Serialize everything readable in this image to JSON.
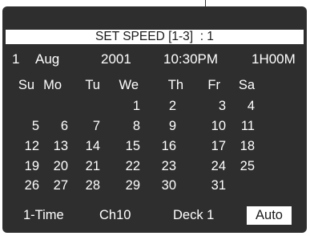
{
  "header": {
    "title": "SET SPEED [1-3]  : 1"
  },
  "date_line": {
    "day": "1",
    "month": "Aug",
    "year": "2001",
    "time": "10:30PM",
    "duration": "1H00M"
  },
  "calendar": {
    "weekdays": [
      "Su",
      "Mo",
      "Tu",
      "We",
      "Th",
      "Fr",
      "Sa"
    ],
    "weeks": [
      [
        "",
        "",
        "",
        "1",
        "2",
        "3",
        "4"
      ],
      [
        "5",
        "6",
        "7",
        "8",
        "9",
        "10",
        "11"
      ],
      [
        "12",
        "13",
        "14",
        "15",
        "16",
        "17",
        "18"
      ],
      [
        "19",
        "20",
        "21",
        "22",
        "23",
        "24",
        "25"
      ],
      [
        "26",
        "27",
        "28",
        "29",
        "30",
        "31",
        ""
      ]
    ]
  },
  "footer": {
    "mode": "1-Time",
    "channel": "Ch10",
    "deck": "Deck 1",
    "speed_mode": "Auto"
  },
  "colors": {
    "screen_background": "#2e2e2e",
    "text": "#ffffff",
    "highlight_background": "#ffffff",
    "highlight_text": "#1a1a1a"
  }
}
